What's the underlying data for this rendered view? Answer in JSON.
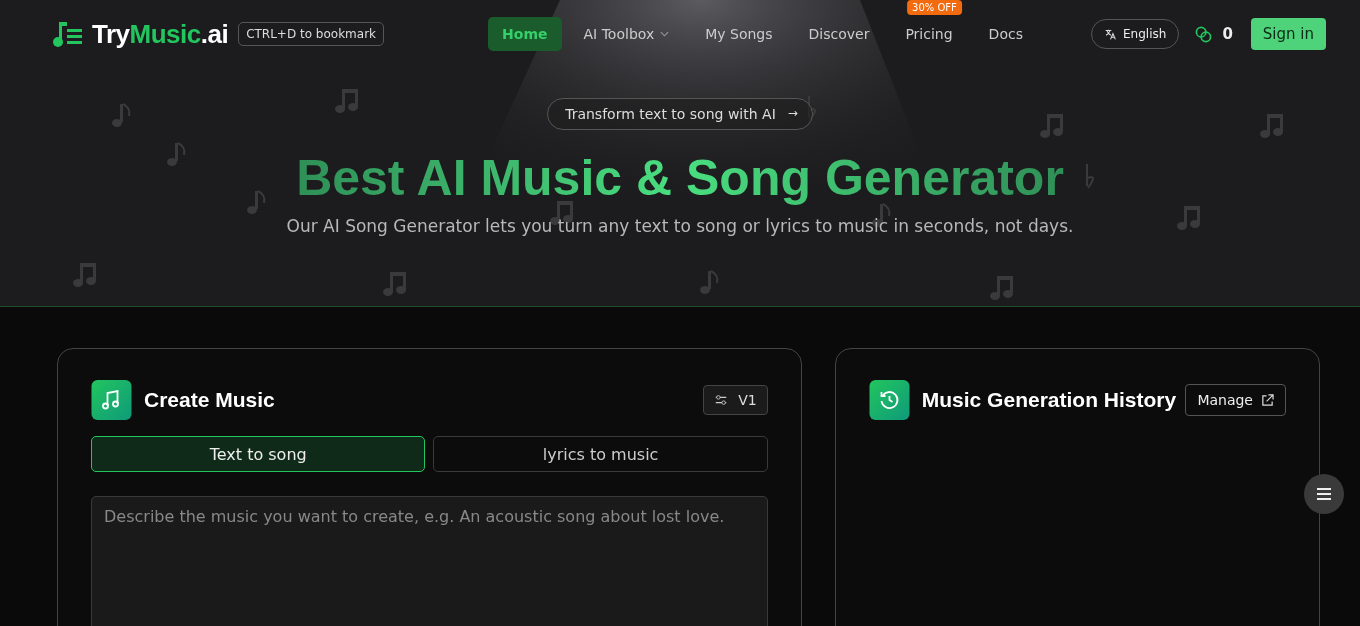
{
  "logo": {
    "prefix": "Try",
    "highlight": "Music",
    "suffix": ".ai"
  },
  "bookmark_hint": "CTRL+D to bookmark",
  "nav": [
    {
      "label": "Home",
      "selected": true,
      "kind": "link"
    },
    {
      "label": "AI Toolbox",
      "selected": false,
      "kind": "dropdown"
    },
    {
      "label": "My Songs",
      "selected": false,
      "kind": "link"
    },
    {
      "label": "Discover",
      "selected": false,
      "kind": "link"
    },
    {
      "label": "Pricing",
      "selected": false,
      "kind": "link",
      "badge": "30% OFF"
    },
    {
      "label": "Docs",
      "selected": false,
      "kind": "link"
    }
  ],
  "language": "English",
  "credits": "0",
  "sign_in": "Sign in",
  "hero": {
    "pill": "Transform text to song with AI",
    "pill_arrow": "→",
    "title": "Best AI Music & Song Generator",
    "subtitle": "Our AI Song Generator lets you turn any text to song or lyrics to music in seconds, not days."
  },
  "create": {
    "title": "Create Music",
    "version": "V1",
    "tabs": [
      {
        "label": "Text to song",
        "selected": true
      },
      {
        "label": "lyrics to music",
        "selected": false
      }
    ],
    "prompt": {
      "placeholder": "Describe the music you want to create, e.g. An acoustic song about lost love."
    }
  },
  "history": {
    "title": "Music Generation History",
    "manage": "Manage"
  }
}
